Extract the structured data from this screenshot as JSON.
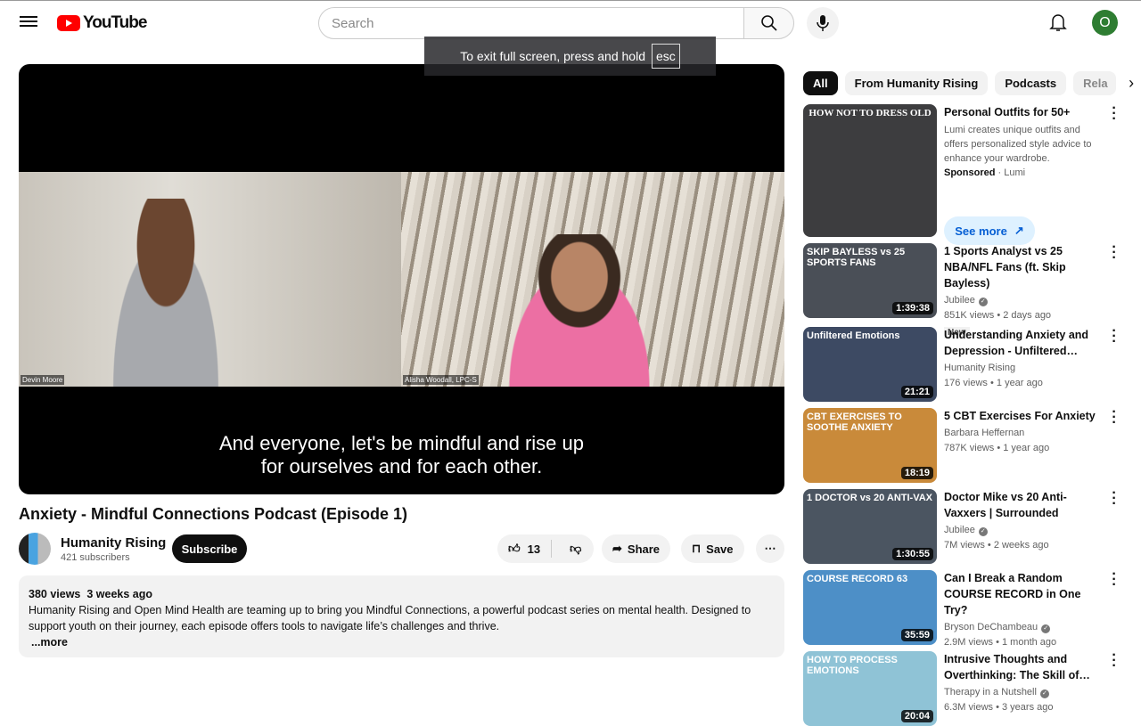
{
  "header": {
    "logo_text": "YouTube",
    "search_placeholder": "Search",
    "avatar_letter": "O"
  },
  "toast": {
    "text": "To exit full screen, press and hold",
    "key": "esc"
  },
  "player": {
    "speaker1": "Devin Moore",
    "speaker2": "Alisha Woodall, LPC-S",
    "subtitle_line1": "And everyone, let's be mindful and rise up",
    "subtitle_line2": "for ourselves and for each other."
  },
  "video": {
    "title": "Anxiety - Mindful Connections Podcast (Episode 1)",
    "channel": "Humanity Rising",
    "subscribers": "421 subscribers",
    "subscribe_label": "Subscribe",
    "likes": "13",
    "share_label": "Share",
    "save_label": "Save",
    "views": "380 views",
    "date": "3 weeks ago",
    "description": "Humanity Rising and Open Mind Health are teaming up to bring you Mindful Connections, a powerful podcast series on mental health. Designed to support youth on their journey, each episode offers tools to navigate life’s challenges and thrive.",
    "more_label": "...more"
  },
  "chips": [
    "All",
    "From Humanity Rising",
    "Podcasts",
    "Rela"
  ],
  "ad": {
    "thumb_text": "HOW NOT TO DRESS OLD",
    "title": "Personal Outfits for 50+",
    "body": "Lumi creates unique outfits and offers personalized style advice to enhance your wardrobe.",
    "sponsored": "Sponsored",
    "advertiser": "· Lumi",
    "cta": "See more"
  },
  "recs": [
    {
      "thumb_text": "SKIP BAYLESS vs 25 SPORTS FANS",
      "title": "1 Sports Analyst vs 25 NBA/NFL Fans (ft. Skip Bayless)",
      "channel": "Jubilee",
      "verified": true,
      "views": "851K views",
      "age": "• 2 days ago",
      "badge": "New",
      "duration": "1:39:38",
      "color": "#4a4f57"
    },
    {
      "thumb_text": "Unfiltered Emotions",
      "title": "Understanding Anxiety and Depression - Unfiltered…",
      "channel": "Humanity Rising",
      "verified": false,
      "views": "176 views",
      "age": "• 1 year ago",
      "duration": "21:21",
      "color": "#3d4a63"
    },
    {
      "thumb_text": "CBT EXERCISES TO SOOTHE ANXIETY",
      "title": "5 CBT Exercises For Anxiety",
      "channel": "Barbara Heffernan",
      "verified": false,
      "views": "787K views",
      "age": "• 1 year ago",
      "duration": "18:19",
      "color": "#c98a3a"
    },
    {
      "thumb_text": "1 DOCTOR vs 20 ANTI-VAX",
      "title": "Doctor Mike vs 20 Anti-Vaxxers | Surrounded",
      "channel": "Jubilee",
      "verified": true,
      "views": "7M views",
      "age": "• 2 weeks ago",
      "duration": "1:30:55",
      "color": "#4b5561"
    },
    {
      "thumb_text": "COURSE RECORD 63",
      "title": "Can I Break a Random COURSE RECORD in One Try?",
      "channel": "Bryson DeChambeau",
      "verified": true,
      "views": "2.9M views",
      "age": "• 1 month ago",
      "duration": "35:59",
      "color": "#4d8fc7"
    },
    {
      "thumb_text": "HOW TO PROCESS EMOTIONS",
      "title": "Intrusive Thoughts and Overthinking: The Skill of…",
      "channel": "Therapy in a Nutshell",
      "verified": true,
      "views": "6.3M views",
      "age": "• 3 years ago",
      "duration": "20:04",
      "color": "#8fc3d6"
    }
  ]
}
